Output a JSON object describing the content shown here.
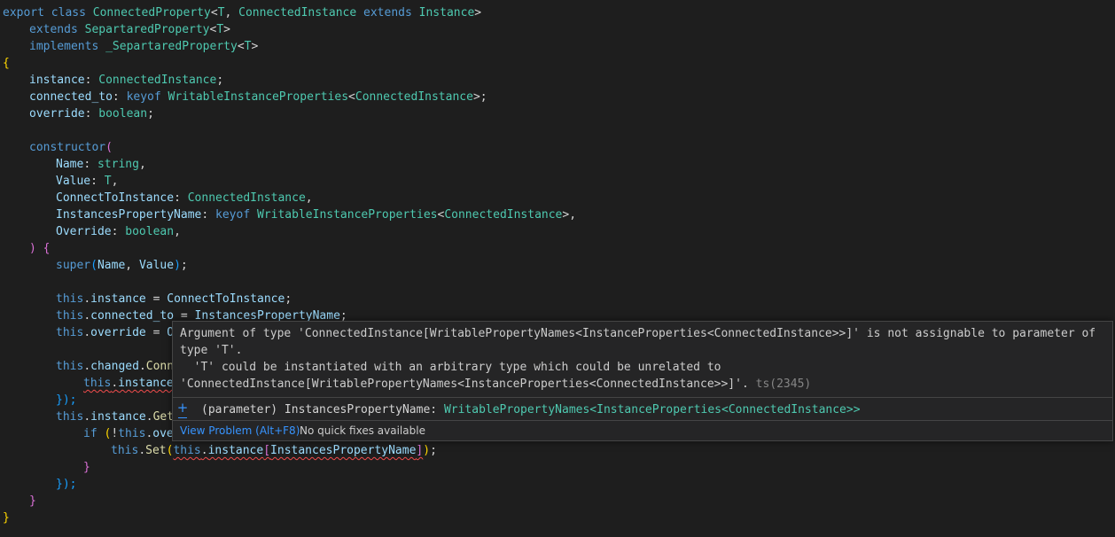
{
  "code": {
    "l1": {
      "export": "export",
      "class": "class",
      "name": "ConnectedProperty",
      "lt": "<",
      "T": "T",
      "comma": ", ",
      "ci": "ConnectedInstance",
      "extends": "extends",
      "inst": "Instance",
      "gt": ">"
    },
    "l2": {
      "extends": "extends",
      "base": "SepartaredProperty",
      "lt": "<",
      "T": "T",
      "gt": ">"
    },
    "l3": {
      "implements": "implements",
      "iface": "_SepartaredProperty",
      "lt": "<",
      "T": "T",
      "gt": ">"
    },
    "l4": {
      "brace": "{"
    },
    "l5": {
      "prop": "instance",
      "colon": ": ",
      "type": "ConnectedInstance",
      "semi": ";"
    },
    "l6": {
      "prop": "connected_to",
      "colon": ": ",
      "keyof": "keyof",
      "type": "WritableInstanceProperties",
      "lt": "<",
      "ci": "ConnectedInstance",
      "gt": ">",
      "semi": ";"
    },
    "l7": {
      "prop": "override",
      "colon": ": ",
      "type": "boolean",
      "semi": ";"
    },
    "l9": {
      "ctor": "constructor",
      "paren": "("
    },
    "l10": {
      "p": "Name",
      "colon": ": ",
      "type": "string",
      "comma": ","
    },
    "l11": {
      "p": "Value",
      "colon": ": ",
      "type": "T",
      "comma": ","
    },
    "l12": {
      "p": "ConnectToInstance",
      "colon": ": ",
      "type": "ConnectedInstance",
      "comma": ","
    },
    "l13": {
      "p": "InstancesPropertyName",
      "colon": ": ",
      "keyof": "keyof",
      "type": "WritableInstanceProperties",
      "lt": "<",
      "ci": "ConnectedInstance",
      "gt": ">",
      "comma": ","
    },
    "l14": {
      "p": "Override",
      "colon": ": ",
      "type": "boolean",
      "comma": ","
    },
    "l15": {
      "paren": ")",
      "brace": "{"
    },
    "l16": {
      "super": "super",
      "paren_o": "(",
      "a": "Name",
      "comma": ", ",
      "b": "Value",
      "paren_c": ")",
      "semi": ";"
    },
    "l18": {
      "this": "this",
      "dot": ".",
      "prop": "instance",
      "eq": " = ",
      "val": "ConnectToInstance",
      "semi": ";"
    },
    "l19": {
      "this": "this",
      "dot": ".",
      "prop": "connected_to",
      "eq": " = ",
      "val": "InstancesPropertyName",
      "semi": ";"
    },
    "l20": {
      "this": "this",
      "dot": ".",
      "prop": "override",
      "eq": " = ",
      "val": "O"
    },
    "l22": {
      "this": "this",
      "dot": ".",
      "prop": "changed",
      "dot2": ".",
      "rest": "Conn"
    },
    "l23": {
      "this": "this",
      "dot": ".",
      "prop": "instance"
    },
    "l24": {
      "close": "});"
    },
    "l25": {
      "this": "this",
      "dot": ".",
      "prop": "instance",
      "dot2": ".",
      "rest": "Get"
    },
    "l26": {
      "if": "if",
      "sp": " ",
      "paren": "(",
      "not": "!",
      "this": "this",
      "dot": ".",
      "rest": "ove"
    },
    "l27": {
      "this": "this",
      "dot": ".",
      "fn": "Set",
      "paren_o": "(",
      "this2": "this",
      "dot2": ".",
      "prop": "instance",
      "bo": "[",
      "idx": "InstancesPropertyName",
      "bc": "]",
      "paren_c": ")",
      "semi": ";"
    },
    "l28": {
      "brace": "}"
    },
    "l29": {
      "close": "});"
    },
    "l30": {
      "brace": "}"
    },
    "l31": {
      "brace": "}"
    }
  },
  "hover": {
    "message_line1": "Argument of type 'ConnectedInstance[WritablePropertyNames<InstanceProperties<ConnectedInstance>>]' is not assignable to parameter of",
    "message_line2": "type 'T'.",
    "message_line3": "  'T' could be instantiated with an arbitrary type which could be unrelated to",
    "message_line4": "'ConnectedInstance[WritablePropertyNames<InstanceProperties<ConnectedInstance>>]'.",
    "error_code": "ts(2345)",
    "expand_icon": "plus-icon",
    "signature_prefix": "(parameter) InstancesPropertyName: ",
    "signature_type": "WritablePropertyNames<InstanceProperties<ConnectedInstance>>",
    "view_problem": "View Problem (Alt+F8)",
    "no_quick_fixes": "No quick fixes available"
  },
  "colors": {
    "background": "#1e1e1e",
    "keyword": "#569cd6",
    "type": "#4ec9b0",
    "variable": "#9cdcfe",
    "function": "#dcdcaa",
    "error_squiggle": "#f14c4c",
    "link": "#3794ff"
  }
}
